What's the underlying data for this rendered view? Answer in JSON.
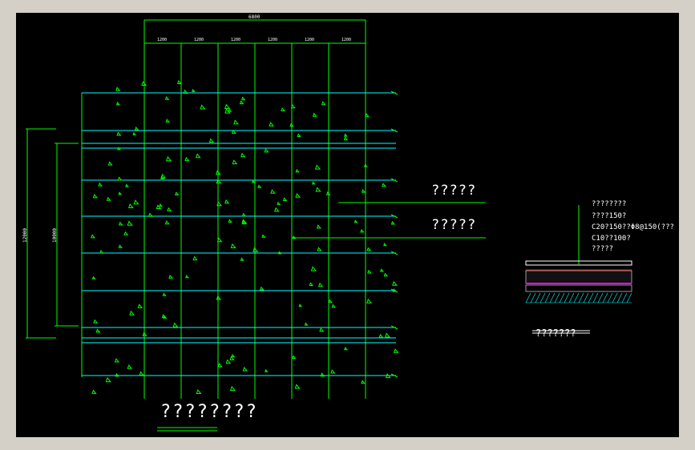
{
  "drawing": {
    "plan_title": "????????",
    "section_title": "???????",
    "callout_top": "?????",
    "callout_bottom": "?????",
    "layers": [
      "????????",
      "????150?",
      "C20?150??Φ8@150(???",
      "C10??100?",
      "?????"
    ],
    "dim_top_total": "6800",
    "dim_top_segments": [
      "1200",
      "1200",
      "1200",
      "1200",
      "1200",
      "1200"
    ],
    "dim_left_total": "12000",
    "dim_left_inner": "10000",
    "colors": {
      "background": "#000000",
      "grid": "#00ffff",
      "frame": "#00ff00",
      "text": "#ffffff",
      "rebar": "#ff00ff"
    }
  }
}
